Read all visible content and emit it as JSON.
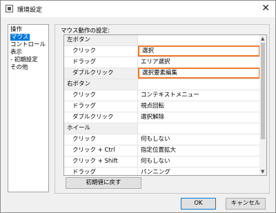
{
  "window": {
    "title": "環境設定",
    "close_glyph": "✕"
  },
  "sidebar": {
    "items": [
      {
        "label": "操作",
        "selected": false
      },
      {
        "label": "マウス",
        "selected": true
      },
      {
        "label": "コントロール",
        "selected": false
      },
      {
        "label": "表示",
        "selected": false
      },
      {
        "label": "- 初期設定",
        "selected": false
      },
      {
        "label": "その他",
        "selected": false
      }
    ]
  },
  "mouse_settings": {
    "group_label": "マウス動作の設定:",
    "rows": [
      {
        "kind": "category",
        "action": "左ボタン",
        "value": ""
      },
      {
        "kind": "item",
        "action": "クリック",
        "value": "選択",
        "editing": true
      },
      {
        "kind": "item",
        "action": "ドラッグ",
        "value": "エリア選択"
      },
      {
        "kind": "item",
        "action": "ダブルクリック",
        "value": "選択要素編集",
        "editing": true
      },
      {
        "kind": "category",
        "action": "右ボタン",
        "value": ""
      },
      {
        "kind": "item",
        "action": "クリック",
        "value": "コンテキストメニュー"
      },
      {
        "kind": "item",
        "action": "ドラッグ",
        "value": "視点回転"
      },
      {
        "kind": "item",
        "action": "ダブルクリック",
        "value": "選択解除"
      },
      {
        "kind": "category",
        "action": "ホイール",
        "value": ""
      },
      {
        "kind": "item",
        "action": "クリック",
        "value": "何もしない"
      },
      {
        "kind": "item",
        "action": "クリック + Ctrl",
        "value": "指定位置拡大"
      },
      {
        "kind": "item",
        "action": "クリック + Shift",
        "value": "何もしない"
      },
      {
        "kind": "item",
        "action": "ドラッグ",
        "value": "パンニング"
      }
    ],
    "reset_label": "初期値に戻す"
  },
  "footer": {
    "ok_label": "OK",
    "cancel_label": "キャンセル"
  },
  "colors": {
    "selection": "#0078d7",
    "edit_border": "#e9792f"
  }
}
